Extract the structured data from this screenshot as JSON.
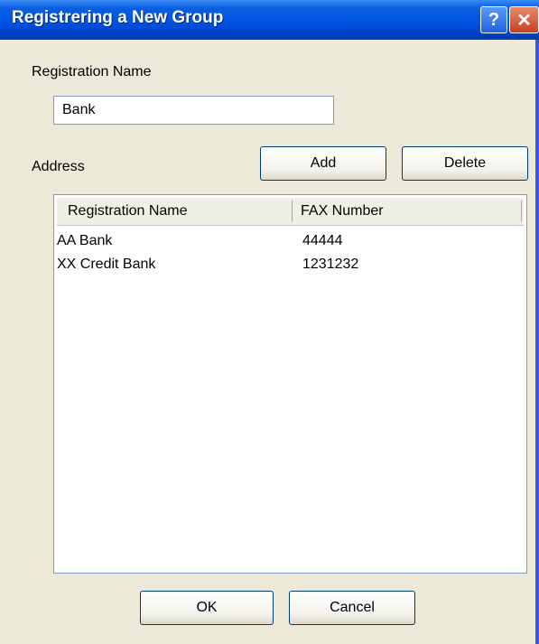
{
  "window": {
    "title": "Registrering a New Group",
    "help_glyph": "?",
    "close_glyph": "✕"
  },
  "form": {
    "registration_name_label": "Registration Name",
    "registration_name_value": "Bank",
    "address_label": "Address",
    "add_label": "Add",
    "delete_label": "Delete"
  },
  "table": {
    "columns": [
      "Registration Name",
      "FAX Number"
    ],
    "rows": [
      {
        "name": "AA Bank",
        "fax": "44444"
      },
      {
        "name": "XX Credit Bank",
        "fax": "1231232"
      }
    ]
  },
  "footer": {
    "ok_label": "OK",
    "cancel_label": "Cancel"
  },
  "colors": {
    "titlebar": "#0054e3",
    "dialog_bg": "#ece9d8",
    "close_button": "#c8401f"
  },
  "icons": {
    "help": "help-icon",
    "close": "close-icon"
  }
}
